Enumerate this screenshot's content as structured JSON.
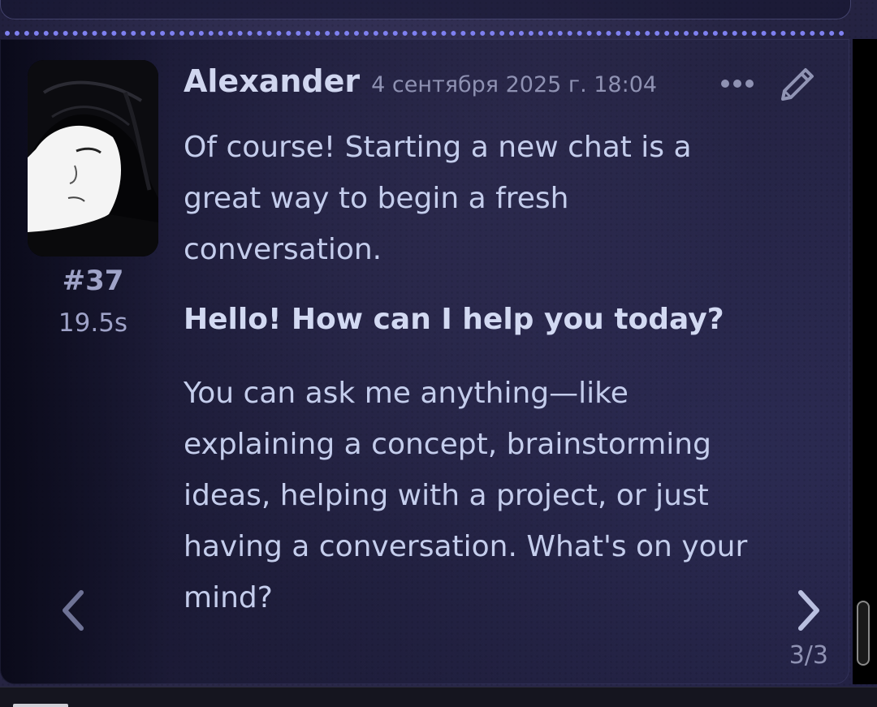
{
  "message": {
    "author": "Alexander",
    "timestamp": "4 сентября 2025 г. 18:04",
    "id": "#37",
    "generation_time": "19.5s",
    "paragraphs": [
      "Of course! Starting a new chat is a great way to begin a fresh conversation.",
      "Hello! How can I help you today?",
      "You can ask me anything—like explaining a concept, brainstorming ideas, helping with a project, or just having a conversation. What's on your mind?"
    ],
    "swipe_counter": "3/3"
  },
  "icons": {
    "more": "more-dots-icon",
    "edit": "pencil-icon",
    "swipe_left": "chevron-left-icon",
    "swipe_right": "chevron-right-icon"
  },
  "colors": {
    "separator": "#7e80f0",
    "text": "#c4cdec",
    "author": "#d0d6ef",
    "muted": "#8f92b3"
  }
}
